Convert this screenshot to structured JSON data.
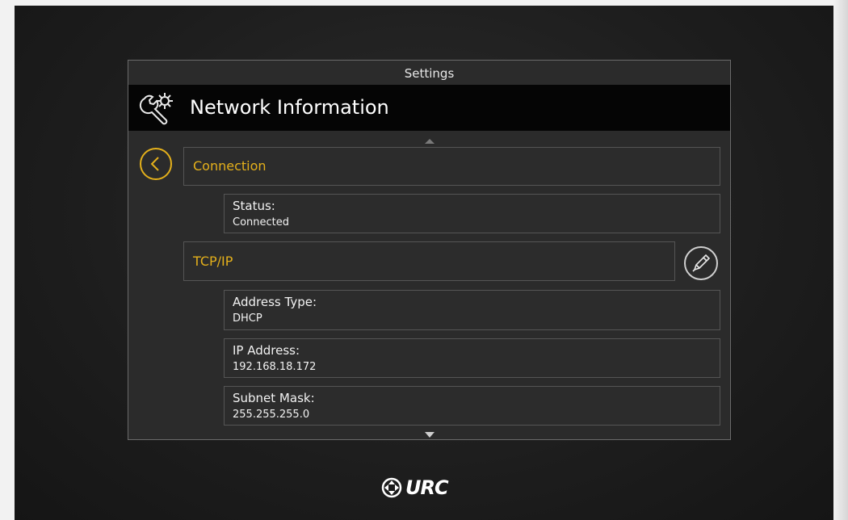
{
  "panel": {
    "title": "Settings",
    "header": "Network Information",
    "header_icon": "wrench-gear-icon"
  },
  "sections": [
    {
      "label": "Connection",
      "fields": [
        {
          "label": "Status:",
          "value": "Connected"
        }
      ]
    },
    {
      "label": "TCP/IP",
      "fields": [
        {
          "label": "Address Type:",
          "value": "DHCP"
        },
        {
          "label": "IP Address:",
          "value": "192.168.18.172"
        },
        {
          "label": "Subnet Mask:",
          "value": "255.255.255.0"
        }
      ]
    }
  ],
  "controls": {
    "back_icon": "chevron-left-icon",
    "edit_icon": "pencil-icon",
    "scroll_up_icon": "triangle-up-icon",
    "scroll_down_icon": "triangle-down-icon"
  },
  "brand": {
    "logo": "URC",
    "accent_color": "#e4b01b"
  }
}
